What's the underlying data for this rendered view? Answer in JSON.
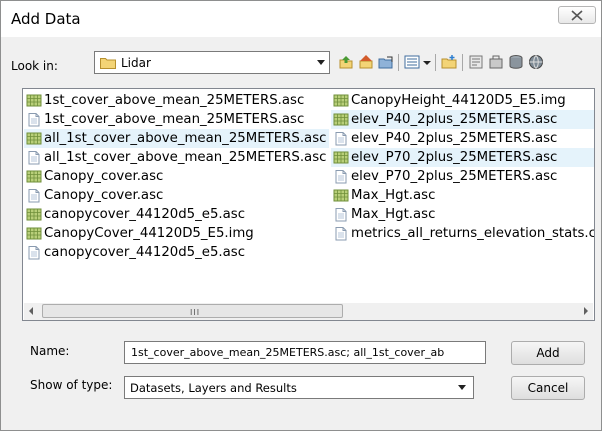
{
  "window": {
    "title": "Add Data"
  },
  "lookin": {
    "label": "Look in:",
    "value": "Lidar"
  },
  "files": {
    "column1": [
      {
        "name": "1st_cover_above_mean_25METERS.asc",
        "icon": "raster-grid-icon",
        "selected": false
      },
      {
        "name": "1st_cover_above_mean_25METERS.asc",
        "icon": "text-file-icon",
        "selected": false
      },
      {
        "name": "all_1st_cover_above_mean_25METERS.asc",
        "icon": "raster-grid-icon",
        "selected": true
      },
      {
        "name": "all_1st_cover_above_mean_25METERS.asc",
        "icon": "text-file-icon",
        "selected": false
      },
      {
        "name": "Canopy_cover.asc",
        "icon": "raster-grid-icon",
        "selected": false
      },
      {
        "name": "Canopy_cover.asc",
        "icon": "text-file-icon",
        "selected": false
      },
      {
        "name": "canopycover_44120d5_e5.asc",
        "icon": "raster-grid-icon",
        "selected": false
      },
      {
        "name": "CanopyCover_44120D5_E5.img",
        "icon": "raster-grid-icon",
        "selected": false
      },
      {
        "name": "canopycover_44120d5_e5.asc",
        "icon": "text-file-icon",
        "selected": false
      }
    ],
    "column2": [
      {
        "name": "CanopyHeight_44120D5_E5.img",
        "icon": "raster-grid-icon",
        "selected": false
      },
      {
        "name": "elev_P40_2plus_25METERS.asc",
        "icon": "raster-grid-icon",
        "selected": true
      },
      {
        "name": "elev_P40_2plus_25METERS.asc",
        "icon": "text-file-icon",
        "selected": false
      },
      {
        "name": "elev_P70_2plus_25METERS.asc",
        "icon": "raster-grid-icon",
        "selected": true
      },
      {
        "name": "elev_P70_2plus_25METERS.asc",
        "icon": "text-file-icon",
        "selected": false
      },
      {
        "name": "Max_Hgt.asc",
        "icon": "raster-grid-icon",
        "selected": false
      },
      {
        "name": "Max_Hgt.asc",
        "icon": "text-file-icon",
        "selected": false
      },
      {
        "name": "metrics_all_returns_elevation_stats.cs",
        "icon": "text-file-icon",
        "selected": false
      }
    ]
  },
  "scrollbar": {
    "grip": "III"
  },
  "name": {
    "label": "Name:",
    "value": "1st_cover_above_mean_25METERS.asc; all_1st_cover_ab"
  },
  "type": {
    "label": "Show of type:",
    "value": "Datasets, Layers and Results"
  },
  "buttons": {
    "add": "Add",
    "cancel": "Cancel"
  },
  "toolbar_icons": [
    "up-one-level-icon",
    "home-icon",
    "connect-folder-icon",
    "view-list-icon",
    "new-folder-icon",
    "catalog-icon",
    "toolbox-icon",
    "database-icon",
    "globe-icon"
  ],
  "colors": {
    "selection": "#e5f3fb",
    "grid_icon": "#6f8f3a",
    "folder": "#e8c25a"
  }
}
